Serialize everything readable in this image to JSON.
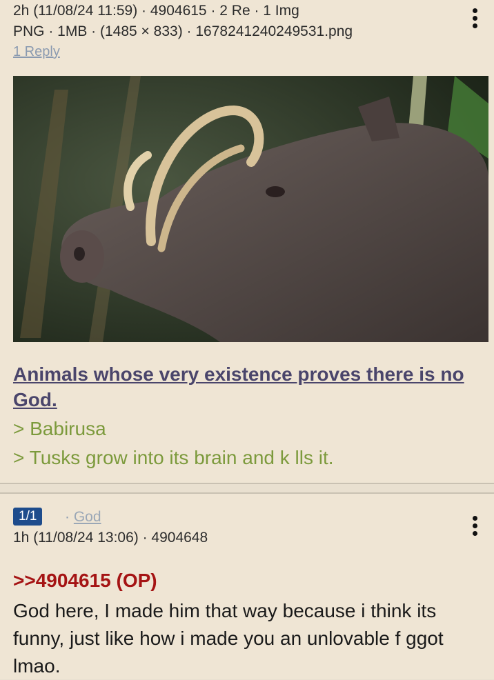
{
  "op": {
    "meta_line1": "2h (11/08/24 11:59) · 4904615 · 2 Re · 1 Img",
    "meta_line2": "PNG · 1MB · (1485 × 833) · 1678241240249531.png",
    "reply_link": "1 Reply",
    "image_subject": "babirusa",
    "subject": "Animals whose very existence proves there is no God.",
    "greentext": [
      "> Babirusa",
      "> Tusks grow into its brain and k lls it."
    ]
  },
  "reply": {
    "badge": "1/1",
    "name_sep": " · ",
    "name": "God",
    "meta": "1h (11/08/24 13:06) · 4904648",
    "quote": ">>4904615 (OP)",
    "body": "God here, I made him that way because i think its funny, just like how i made you an unlovable f   ggot lmao."
  }
}
